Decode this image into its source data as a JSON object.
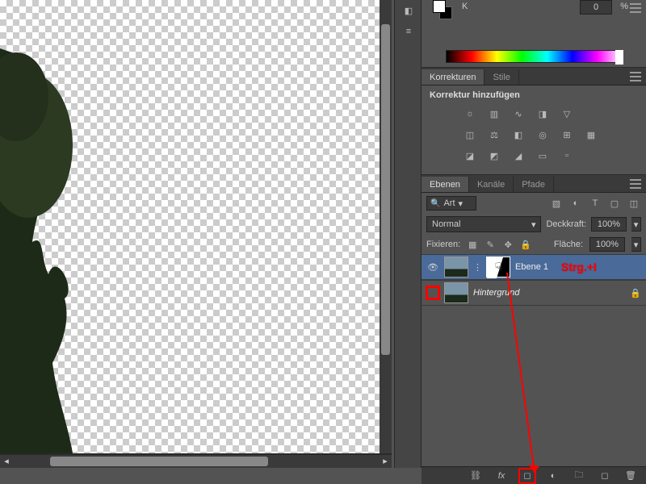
{
  "color_panel": {
    "channel_label": "K",
    "value": "0",
    "unit": "%"
  },
  "adjustments": {
    "tabs": [
      "Korrekturen",
      "Stile"
    ],
    "active_tab": 0,
    "title": "Korrektur hinzufügen"
  },
  "layers_panel": {
    "tabs": [
      "Ebenen",
      "Kanäle",
      "Pfade"
    ],
    "active_tab": 0,
    "search_label": "Art",
    "blend_mode": "Normal",
    "opacity_label": "Deckkraft:",
    "opacity_value": "100%",
    "fill_label": "Fläche:",
    "fill_value": "100%",
    "lock_label": "Fixieren:",
    "layers": [
      {
        "name": "Ebene 1",
        "selected": true,
        "visible": true,
        "has_mask": true,
        "italic": false,
        "locked": false
      },
      {
        "name": "Hintergrund",
        "selected": false,
        "visible": false,
        "has_mask": false,
        "italic": true,
        "locked": true
      }
    ]
  },
  "annotation": {
    "text": "Strg.+I"
  }
}
